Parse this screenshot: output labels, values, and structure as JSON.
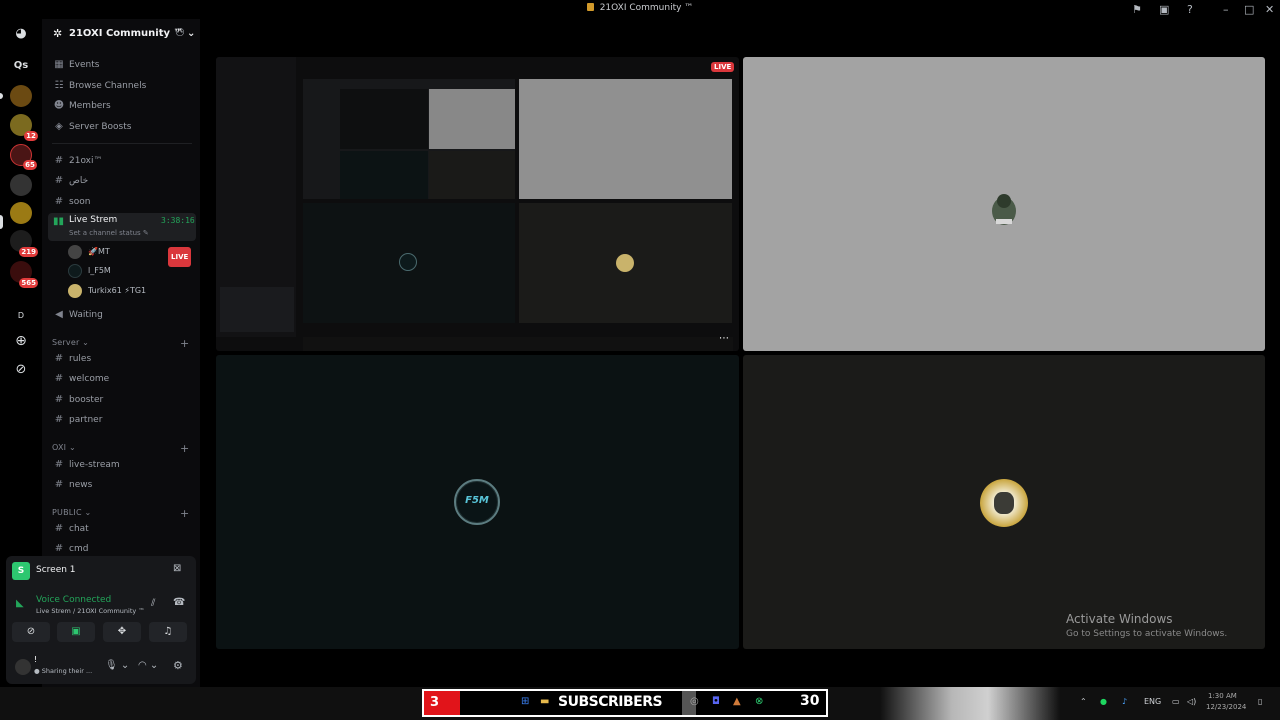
{
  "window": {
    "title": "21OXI Community ™"
  },
  "rail": {
    "home_label": "Qs",
    "badges": [
      "12",
      "65",
      "219",
      "565"
    ],
    "letter_d": "D"
  },
  "guild": {
    "name": "21OXI Community ™ ⌄"
  },
  "nav": [
    {
      "label": "Events",
      "icon": "calendar-icon"
    },
    {
      "label": "Browse Channels",
      "icon": "browse-icon"
    },
    {
      "label": "Members",
      "icon": "members-icon"
    },
    {
      "label": "Server Boosts",
      "icon": "boost-icon"
    }
  ],
  "channels_top": [
    {
      "label": "21oxi™",
      "icon": "hash-icon"
    },
    {
      "label": "خاص",
      "icon": "hash-icon"
    },
    {
      "label": "soon",
      "icon": "hash-icon"
    }
  ],
  "voice_channel": {
    "name": "Live Strem",
    "timer": "3:38:16",
    "status": "Set a channel status ✎",
    "users": [
      {
        "name": "🚀MT",
        "live": "LIVE"
      },
      {
        "name": "l_F5M",
        "live": ""
      },
      {
        "name": "Turkix61 ⚡TG1",
        "live": ""
      }
    ]
  },
  "waiting": "Waiting",
  "categories": [
    {
      "name": "Server ⌄",
      "channels": [
        "rules",
        "welcome",
        "booster",
        "partner"
      ]
    },
    {
      "name": "OXI ⌄",
      "channels": [
        "live-stream",
        "news"
      ]
    },
    {
      "name": "PUBLIC ⌄",
      "channels": [
        "chat",
        "cmd"
      ]
    }
  ],
  "panel": {
    "screen_title": "Screen 1",
    "voice_status": "Voice Connected",
    "voice_location": "Live Strem / 21OXI Community ™",
    "user_status": "Sharing their ..."
  },
  "stage": {
    "live_badge": "LIVE",
    "more": "⋯",
    "tile_f5m_label": "F5M",
    "activate_title": "Activate Windows",
    "activate_sub": "Go to Settings to activate Windows."
  },
  "taskbar": {
    "subs_count": "3",
    "subs_label": "SUBSCRIBERS",
    "subs_goal": "30",
    "lang": "ENG",
    "time": "1:30 AM",
    "date": "12/23/2024"
  },
  "colors": {
    "bg": "#000000",
    "sidebar": "#0b0b0d",
    "green": "#23a55a",
    "live_red": "#da373c",
    "blurple": "#5865f2"
  }
}
